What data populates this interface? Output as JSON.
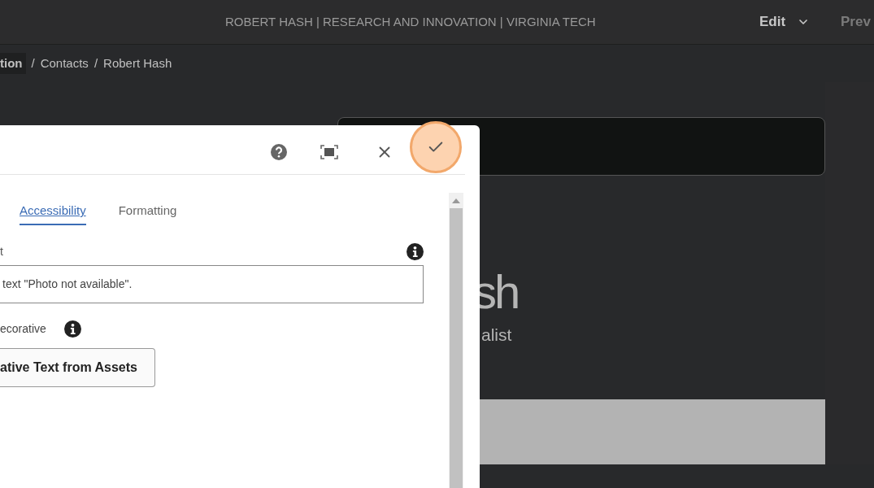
{
  "top_bar": {
    "title": "ROBERT HASH | RESEARCH AND INNOVATION | VIRGINIA TECH",
    "mode_menu": {
      "label": "Edit"
    },
    "preview_button": {
      "label": "Prev"
    }
  },
  "breadcrumb_separator": "/",
  "breadcrumb": [
    {
      "label": "tion",
      "highlighted": true
    },
    {
      "label": "Contacts",
      "highlighted": false
    },
    {
      "label": "Robert Hash",
      "highlighted": false
    }
  ],
  "page": {
    "heading": "sh",
    "subtitle": "alist"
  },
  "dialog": {
    "tabs": [
      {
        "label": "Accessibility",
        "selected": true
      },
      {
        "label": "Formatting",
        "selected": false
      }
    ],
    "alt_field": {
      "label": "t",
      "value": "text \"Photo not available\"."
    },
    "decorative": {
      "label": "ecorative"
    },
    "assets_button": {
      "label": "ative Text from Assets"
    }
  }
}
